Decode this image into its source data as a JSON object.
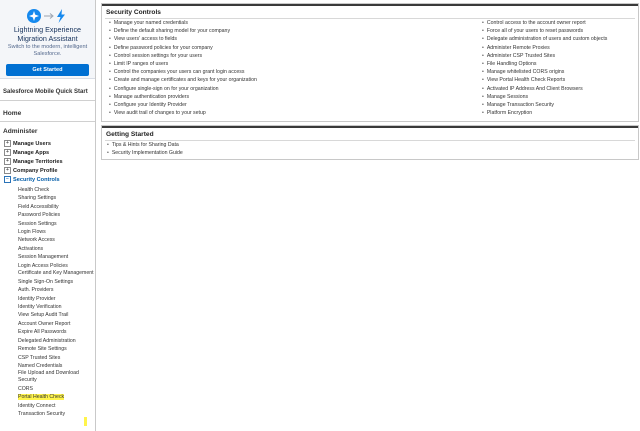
{
  "promo": {
    "title": "Lightning Experience Migration Assistant",
    "subtitle": "Switch to the modern, intelligent Salesforce.",
    "button": "Get Started",
    "accent": "#0070d2",
    "icons": [
      "cloud-icon",
      "arrow-right-icon",
      "lightning-bolt-icon"
    ]
  },
  "mobile_quick_start": "Salesforce Mobile Quick Start",
  "home": "Home",
  "administer": "Administer",
  "nav_top": [
    {
      "label": "Manage Users",
      "expanded": false
    },
    {
      "label": "Manage Apps",
      "expanded": false
    },
    {
      "label": "Manage Territories",
      "expanded": false
    },
    {
      "label": "Company Profile",
      "expanded": false
    },
    {
      "label": "Security Controls",
      "expanded": true
    }
  ],
  "security_children": [
    "Health Check",
    "Sharing Settings",
    "Field Accessibility",
    "Password Policies",
    "Session Settings",
    "Login Flows",
    "Network Access",
    "Activations",
    "Session Management",
    "Login Access Policies",
    "Certificate and Key Management",
    "Single Sign-On Settings",
    "Auth. Providers",
    "Identity Provider",
    "Identity Verification",
    "View Setup Audit Trail",
    "Account Owner Report",
    "Expire All Passwords",
    "Delegated Administration",
    "Remote Site Settings",
    "CSP Trusted Sites",
    "Named Credentials",
    "File Upload and Download Security",
    "CORS",
    "Portal Health Check",
    "Identity Connect",
    "Transaction Security"
  ],
  "highlight_color": "#fff44b",
  "security_panel": {
    "title": "Security Controls",
    "left": [
      "Manage your named credentials",
      "Define the default sharing model for your company",
      "View users' access to fields",
      "Define password policies for your company",
      "Control session settings for your users",
      "Limit IP ranges of users",
      "Control the companies your users can grant login access",
      "Create and manage certificates and keys for your organization",
      "Configure single-sign on for your organization",
      "Manage authentication providers",
      "Configure your Identity Provider",
      "View audit trail of changes to your setup"
    ],
    "right": [
      "Control access to the account owner report",
      "Force all of your users to reset passwords",
      "Delegate administration of users and custom objects",
      "Administer Remote Proxies",
      "Administer CSP Trusted Sites",
      "File Handling Options",
      "Manage whitelisted CORS origins",
      "View Portal Health Check Reports",
      "Activated IP Address And Client Browsers",
      "Manage Sessions",
      "Manage Transaction Security",
      "Platform Encryption"
    ]
  },
  "getting_started": {
    "title": "Getting Started",
    "items": [
      "Tips & Hints for Sharing Data",
      "Security Implementation Guide"
    ]
  }
}
